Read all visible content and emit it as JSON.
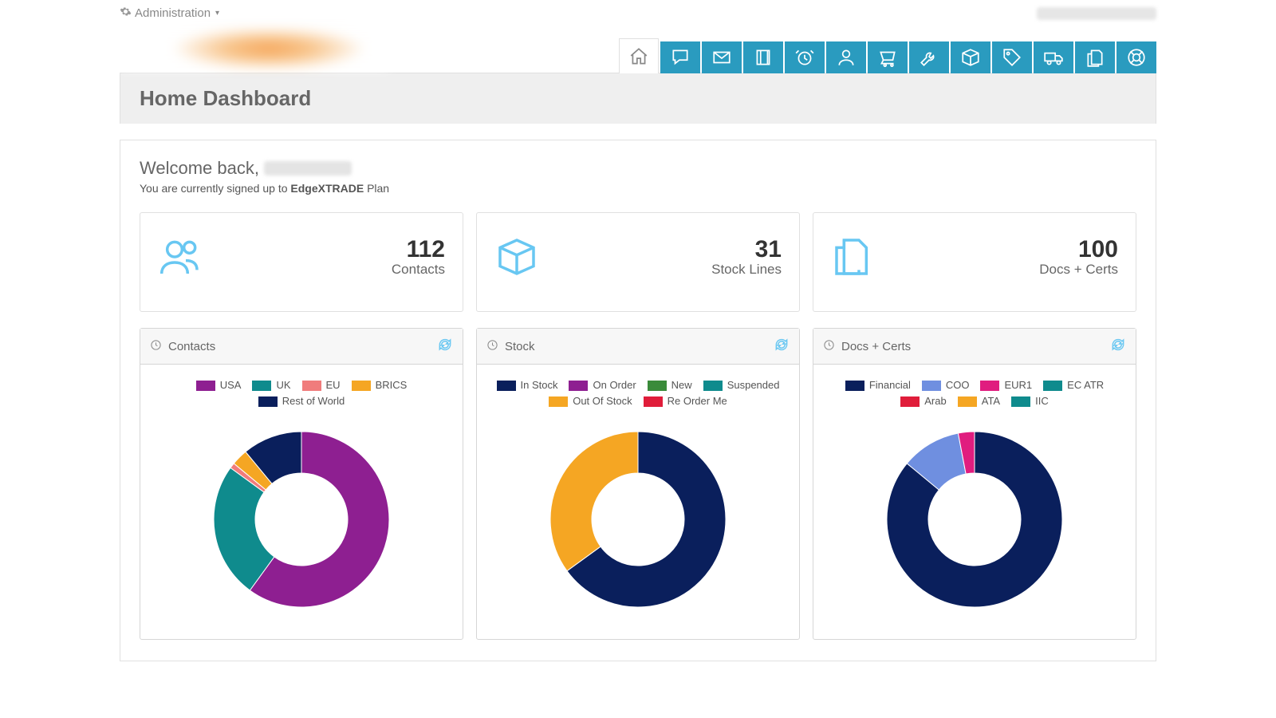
{
  "topbar": {
    "admin_label": "Administration"
  },
  "nav": {
    "items": [
      {
        "name": "home-icon"
      },
      {
        "name": "chat-icon"
      },
      {
        "name": "mail-icon"
      },
      {
        "name": "book-icon"
      },
      {
        "name": "alarm-icon"
      },
      {
        "name": "user-icon"
      },
      {
        "name": "cart-icon"
      },
      {
        "name": "wrench-icon"
      },
      {
        "name": "box-icon"
      },
      {
        "name": "tag-icon"
      },
      {
        "name": "truck-icon"
      },
      {
        "name": "copy-icon"
      },
      {
        "name": "support-icon"
      }
    ]
  },
  "title": "Home Dashboard",
  "welcome": {
    "prefix": "Welcome back, ",
    "plan_prefix": "You are currently signed up to ",
    "plan_name": "EdgeXTRADE",
    "plan_suffix": " Plan"
  },
  "stats": [
    {
      "icon": "people-icon",
      "value": "112",
      "label": "Contacts"
    },
    {
      "icon": "box-icon",
      "value": "31",
      "label": "Stock Lines"
    },
    {
      "icon": "docs-icon",
      "value": "100",
      "label": "Docs + Certs"
    }
  ],
  "panels": [
    {
      "title": "Contacts"
    },
    {
      "title": "Stock"
    },
    {
      "title": "Docs + Certs"
    }
  ],
  "chart_data": [
    {
      "type": "pie",
      "variant": "donut",
      "title": "Contacts",
      "series": [
        {
          "name": "USA",
          "value": 60,
          "color": "#8e1f91"
        },
        {
          "name": "UK",
          "value": 25,
          "color": "#0f8b8d"
        },
        {
          "name": "EU",
          "value": 1,
          "color": "#f07c7c"
        },
        {
          "name": "BRICS",
          "value": 3,
          "color": "#f5a623"
        },
        {
          "name": "Rest of World",
          "value": 11,
          "color": "#0a1f5c"
        }
      ]
    },
    {
      "type": "pie",
      "variant": "donut",
      "title": "Stock",
      "series": [
        {
          "name": "In Stock",
          "value": 65,
          "color": "#0a1f5c"
        },
        {
          "name": "On Order",
          "value": 0,
          "color": "#8e1f91"
        },
        {
          "name": "New",
          "value": 0,
          "color": "#3a8b3a"
        },
        {
          "name": "Suspended",
          "value": 0,
          "color": "#0f8b8d"
        },
        {
          "name": "Out Of Stock",
          "value": 35,
          "color": "#f5a623"
        },
        {
          "name": "Re Order Me",
          "value": 0,
          "color": "#e01d3a"
        }
      ]
    },
    {
      "type": "pie",
      "variant": "donut",
      "title": "Docs + Certs",
      "series": [
        {
          "name": "Financial",
          "value": 86,
          "color": "#0a1f5c"
        },
        {
          "name": "COO",
          "value": 11,
          "color": "#6f8fe0"
        },
        {
          "name": "EUR1",
          "value": 3,
          "color": "#e01d7f"
        },
        {
          "name": "EC ATR",
          "value": 0,
          "color": "#0f8b8d"
        },
        {
          "name": "Arab",
          "value": 0,
          "color": "#e01d3a"
        },
        {
          "name": "ATA",
          "value": 0,
          "color": "#f5a623"
        },
        {
          "name": "IIC",
          "value": 0,
          "color": "#0f8b8d"
        }
      ]
    }
  ]
}
